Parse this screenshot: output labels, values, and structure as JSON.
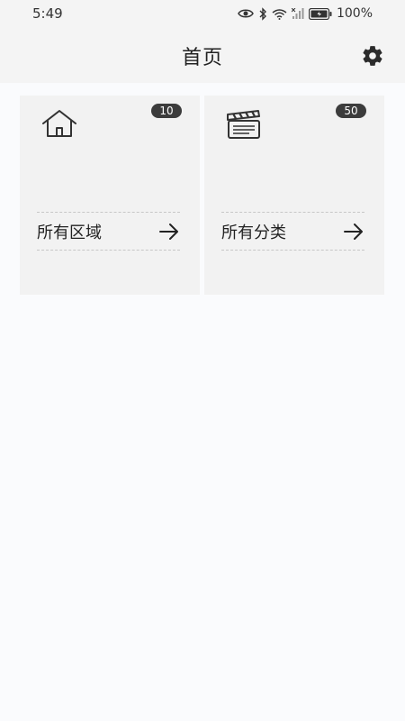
{
  "status_bar": {
    "time": "5:49",
    "icons": [
      "eye-icon",
      "bluetooth-icon",
      "wifi-icon",
      "signal-icon",
      "battery-icon"
    ],
    "battery": "100%"
  },
  "header": {
    "title": "首页",
    "settings_icon": "gear-icon"
  },
  "cards": [
    {
      "icon": "home-icon",
      "badge": "10",
      "label": "所有区域",
      "arrow_icon": "arrow-right-icon"
    },
    {
      "icon": "clapperboard-icon",
      "badge": "50",
      "label": "所有分类",
      "arrow_icon": "arrow-right-icon"
    }
  ],
  "colors": {
    "header_bg": "#f4f4f4",
    "page_bg": "#fafbfd",
    "card_bg": "#f2f2f2",
    "badge_bg": "#3c3c3c"
  }
}
